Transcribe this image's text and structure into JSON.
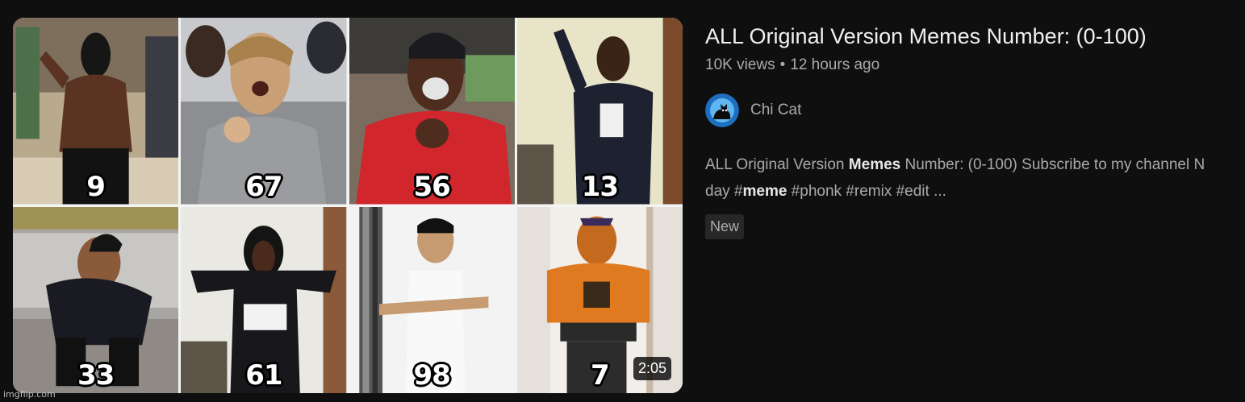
{
  "video": {
    "title": "ALL Original Version Memes Number: (0-100)",
    "views": "10K views",
    "separator": "•",
    "age": "12 hours ago",
    "channel": "Chi Cat",
    "description": {
      "part1": "ALL Original Version ",
      "bold1": "Memes",
      "part2": " Number: (0-100) Subscribe to my channel N",
      "part3": "day #",
      "bold2": "meme",
      "part4": " #phonk #remix #edit ..."
    },
    "badge": "New",
    "duration": "2:05"
  },
  "thumbnail": {
    "tiles": [
      {
        "number": "9"
      },
      {
        "number": "67"
      },
      {
        "number": "56"
      },
      {
        "number": "13"
      },
      {
        "number": "33"
      },
      {
        "number": "61"
      },
      {
        "number": "98"
      },
      {
        "number": "7"
      }
    ]
  },
  "watermark": "imgflip.com",
  "colors": {
    "background": "#0f0f0f",
    "title_text": "#f1f1f1",
    "secondary_text": "#aaaaaa",
    "badge_bg": "#272727",
    "avatar_bg": "#1e6fbf"
  }
}
